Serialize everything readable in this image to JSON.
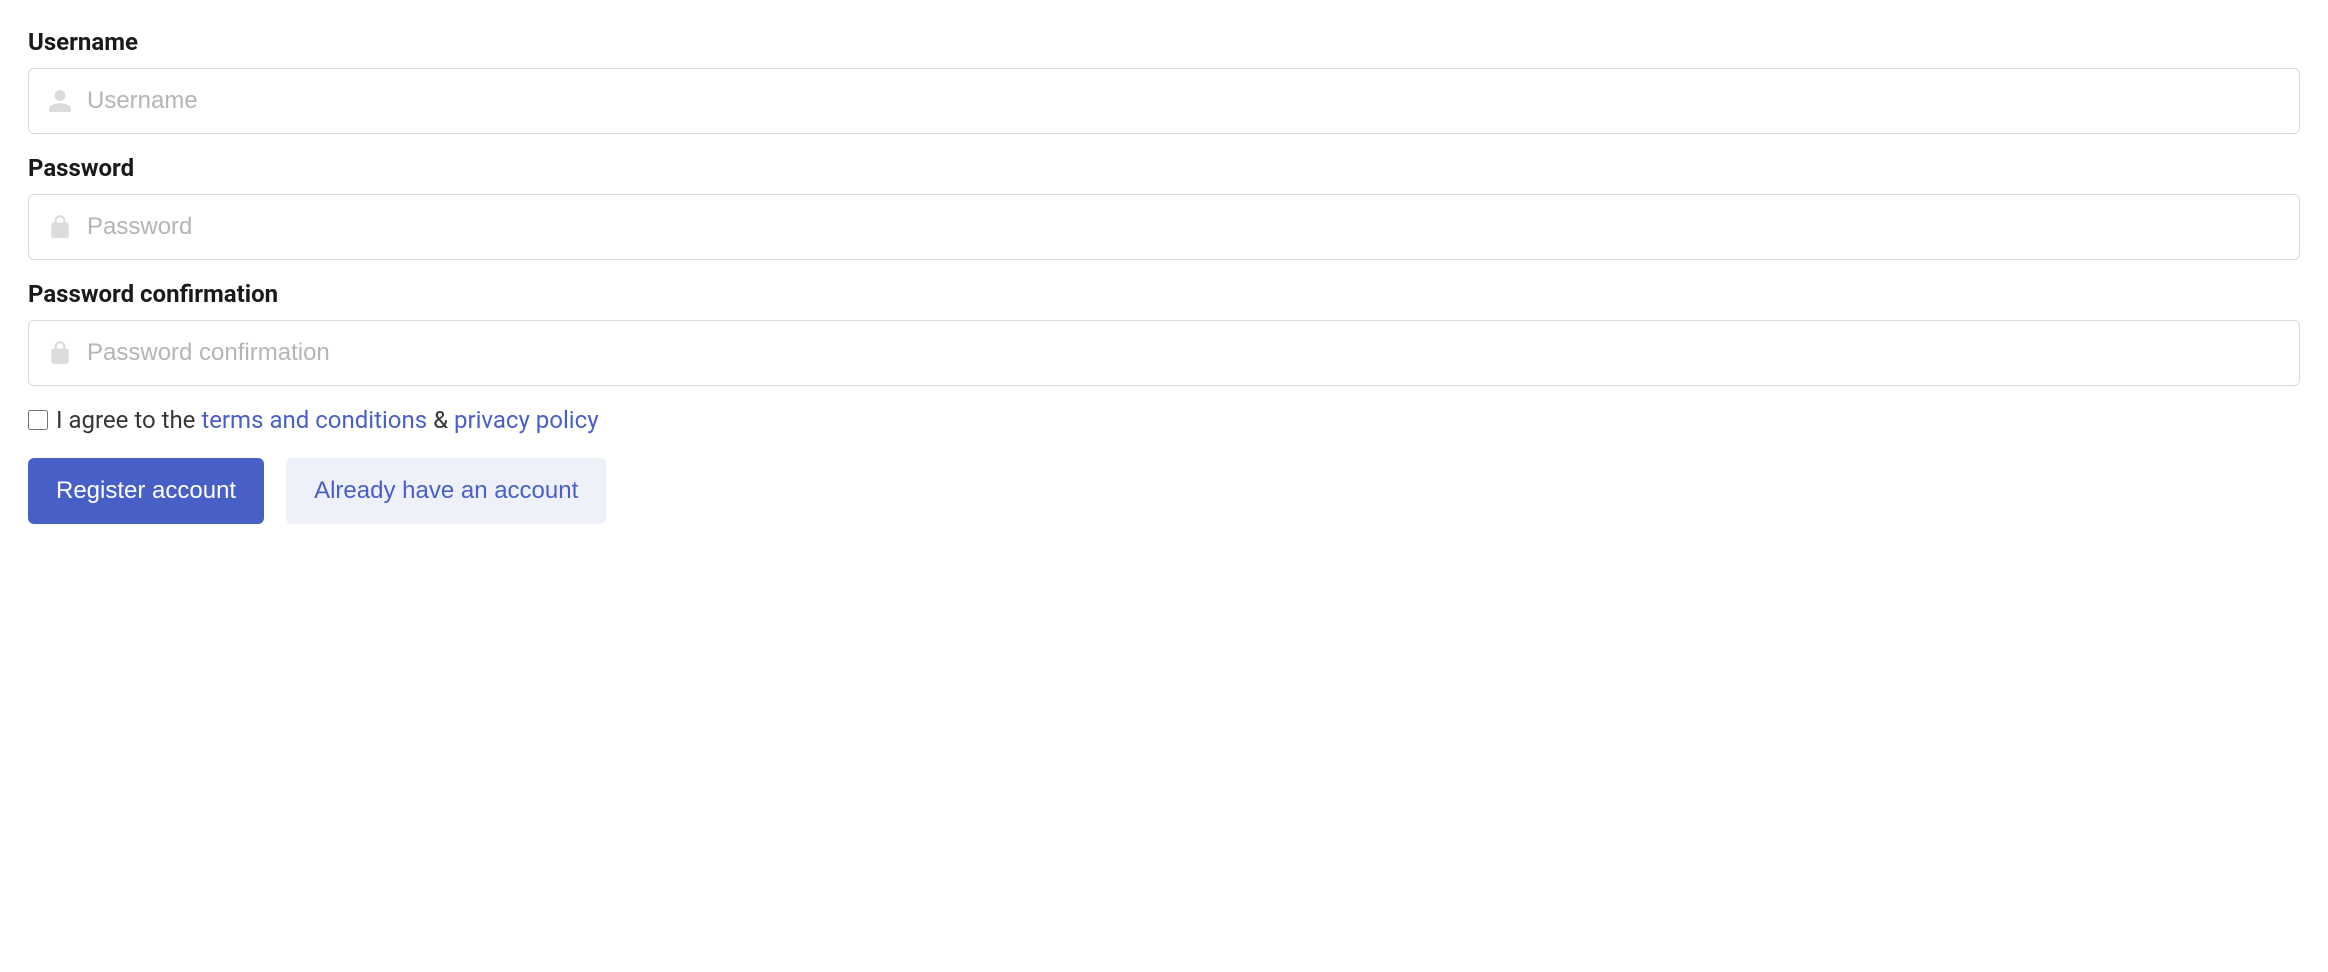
{
  "fields": {
    "username": {
      "label": "Username",
      "placeholder": "Username",
      "value": ""
    },
    "password": {
      "label": "Password",
      "placeholder": "Password",
      "value": ""
    },
    "password_confirmation": {
      "label": "Password confirmation",
      "placeholder": "Password confirmation",
      "value": ""
    }
  },
  "agree": {
    "prefix": "I agree to the ",
    "terms_link": "terms and conditions",
    "separator": " & ",
    "privacy_link": "privacy policy"
  },
  "buttons": {
    "register": "Register account",
    "already": "Already have an account"
  }
}
